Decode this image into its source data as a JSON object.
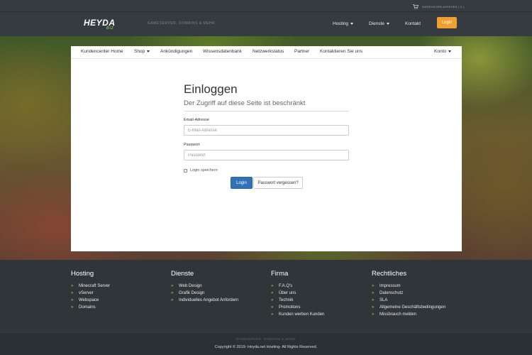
{
  "header": {
    "cart_text": "WARENKORB ANSEHEN ( 0 )",
    "tagline": "GAMESERVER, DOMAINS & MEHR",
    "nav": [
      {
        "label": "Hosting"
      },
      {
        "label": "Dienste"
      },
      {
        "label": "Kontakt"
      }
    ],
    "login_label": "Login",
    "login_color": "#f0a030"
  },
  "subnav": {
    "items": [
      {
        "label": "Kundencenter Home"
      },
      {
        "label": "Shop"
      },
      {
        "label": "Ankündigungen"
      },
      {
        "label": "Wissensdatenbank"
      },
      {
        "label": "Netzwerkstatus"
      },
      {
        "label": "Partner"
      },
      {
        "label": "Kontaktieren Sie uns"
      }
    ],
    "account": "Konto"
  },
  "login": {
    "title": "Einloggen",
    "subtitle": "Der Zugriff auf diese Seite ist beschränkt",
    "email_label": "Email-Adresse",
    "email_placeholder": "E-Mail-Adresse",
    "password_label": "Passwort",
    "password_placeholder": "Passwort",
    "remember_label": "Login speichern",
    "submit_label": "Login",
    "forgot_label": "Passwort vergessen?",
    "primary_color": "#2f73b6"
  },
  "footer": {
    "columns": [
      {
        "heading": "Hosting",
        "links": [
          "Minecraft Server",
          "vServer",
          "Webspace",
          "Domains"
        ]
      },
      {
        "heading": "Dienste",
        "links": [
          "Web Design",
          "Grafik Design",
          "Individuelles Angebot Anfordern"
        ]
      },
      {
        "heading": "Firma",
        "links": [
          "F.A.Q's",
          "Über uns",
          "Technik",
          "Promotions",
          "Kunden werben Kunden"
        ]
      },
      {
        "heading": "Rechtliches",
        "links": [
          "Impressum",
          "Datenschutz",
          "SLA",
          "Allgemeine Geschäftsbedingungen",
          "Missbrauch melden"
        ]
      }
    ],
    "bottom_tagline": "GAMESERVER, DOMAINS & MORE",
    "copyright": "Copyright © 2019- Heyda.net Hosting- All Rights Reserved.",
    "accent_color": "#7fbf3f"
  },
  "icons": {
    "cart": "shopping-cart-icon",
    "chevrons": "double-chevron-right-icon",
    "dropdown": "caret-down-icon"
  }
}
